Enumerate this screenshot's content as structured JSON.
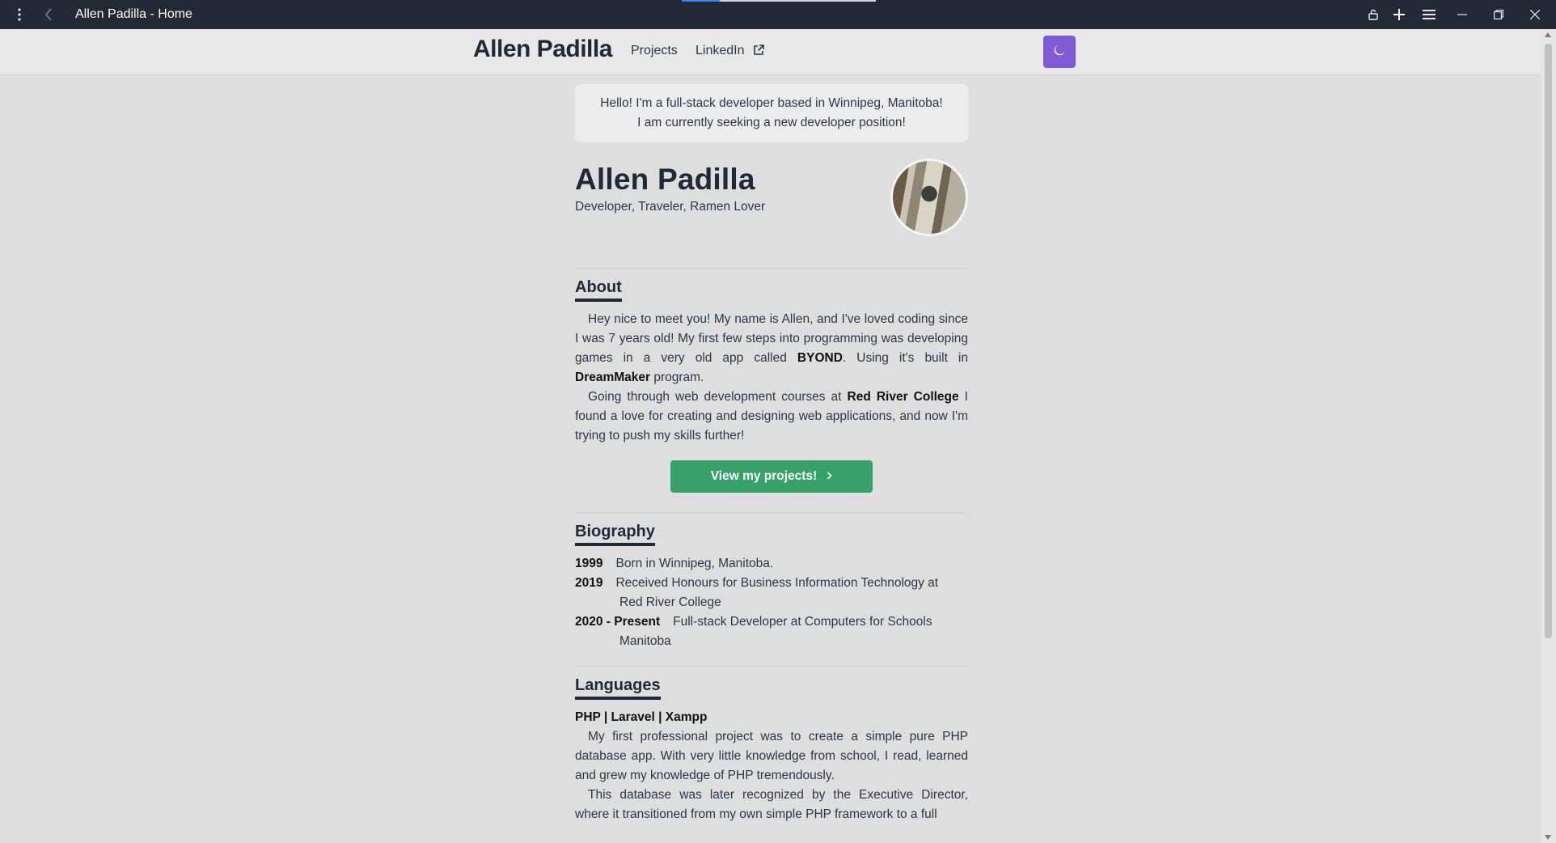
{
  "window": {
    "title": "Allen Padilla - Home"
  },
  "navbar": {
    "brand": "Allen Padilla",
    "links": [
      {
        "label": "Projects"
      },
      {
        "label": "LinkedIn"
      }
    ]
  },
  "intro": {
    "line1": "Hello! I'm a full-stack developer based in Winnipeg, Manitoba!",
    "line2": "I am currently seeking a new developer position!"
  },
  "profile": {
    "name": "Allen Padilla",
    "tagline": "Developer, Traveler, Ramen Lover"
  },
  "about": {
    "title": "About",
    "p1_a": "Hey nice to meet you! My name is Allen, and I've loved coding since I was 7 years old! My first few steps into programming was developing games in a very old app called ",
    "p1_bold1": "BYOND",
    "p1_b": ". Using it's built in ",
    "p1_bold2": "DreamMaker",
    "p1_c": " program.",
    "p2_a": "Going through web development courses at ",
    "p2_bold": "Red River College",
    "p2_b": " I found a love for creating and designing web applications, and now I'm trying to push my skills further!",
    "cta_label": "View my projects!"
  },
  "biography": {
    "title": "Biography",
    "entries": [
      {
        "year": "1999",
        "text": "Born in Winnipeg, Manitoba."
      },
      {
        "year": "2019",
        "text": "Received Honours for Business Information Technology at",
        "cont": "Red River College"
      },
      {
        "year": "2020 - Present",
        "text": "Full-stack Developer at Computers for Schools",
        "cont": "Manitoba"
      }
    ]
  },
  "languages": {
    "title": "Languages",
    "heading": "PHP | Laravel | Xampp",
    "p1": "My first professional project was to create a simple pure PHP database app. With very little knowledge from school, I read, learned and grew my knowledge of PHP tremendously.",
    "p2": "This database was later recognized by the Executive Director, where it transitioned from my own simple PHP framework to a full"
  },
  "colors": {
    "titlebar": "#242a35",
    "theme_button": "#805ad5",
    "cta": "#38a169",
    "page_bg": "#dedede"
  },
  "icons": {
    "theme_toggle": "moon-icon",
    "external_link": "external-link-icon",
    "cta_arrow": "chevron-right-icon"
  }
}
